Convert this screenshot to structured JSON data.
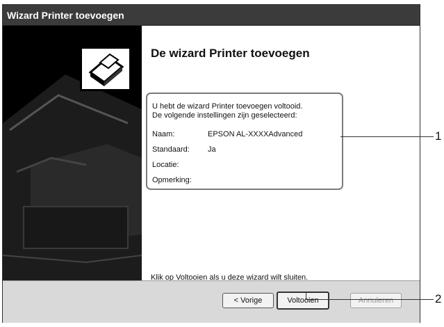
{
  "window": {
    "title": "Wizard Printer toevoegen"
  },
  "main": {
    "heading": "De wizard Printer toevoegen",
    "intro_line1": "U hebt de wizard Printer toevoegen voltooid.",
    "intro_line2": "De volgende instellingen zijn geselecteerd:",
    "settings": [
      {
        "label": "Naam:",
        "value": "EPSON AL-XXXXAdvanced"
      },
      {
        "label": "Standaard:",
        "value": "Ja"
      },
      {
        "label": "Locatie:",
        "value": ""
      },
      {
        "label": "Opmerking:",
        "value": ""
      }
    ],
    "finish_message": "Klik op Voltooien als u deze wizard wilt sluiten."
  },
  "buttons": {
    "back": "< Vorige",
    "finish": "Voltooien",
    "cancel": "Annuleren"
  },
  "callouts": {
    "one": "1",
    "two": "2"
  },
  "colors": {
    "titlebar": "#3b3b3b",
    "left_panel": "#000000",
    "footer": "#d9d9d9"
  }
}
